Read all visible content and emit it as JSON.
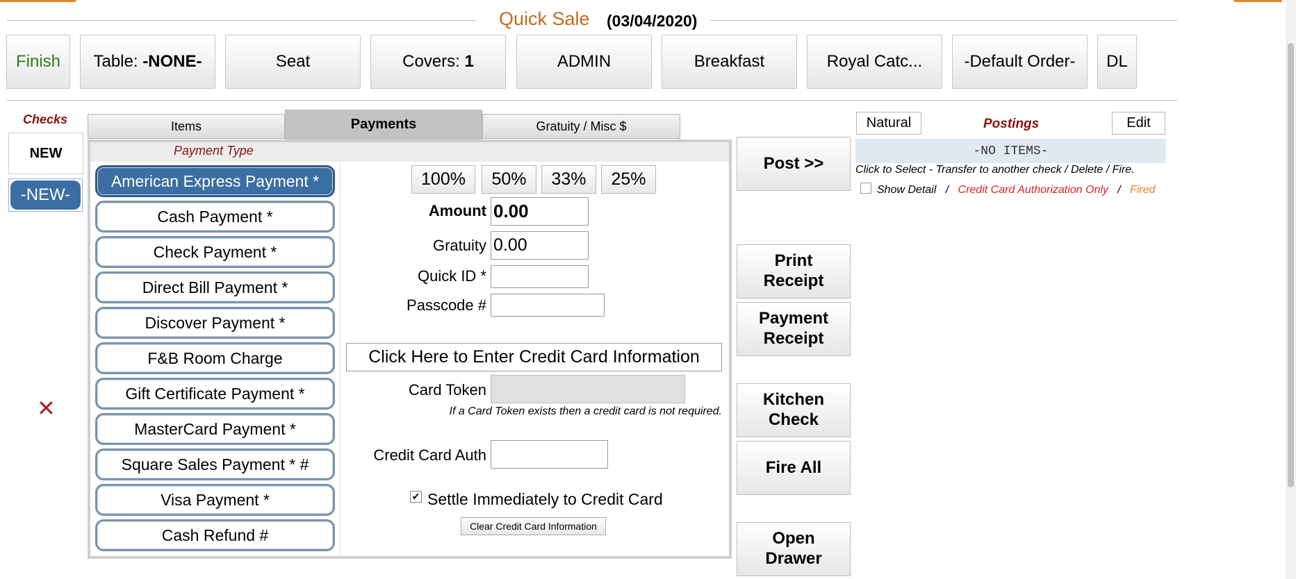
{
  "header": {
    "title": "Quick Sale",
    "date": "(03/04/2020)",
    "buttons": {
      "finish": "Finish",
      "table_label": "Table:",
      "table_value": "-NONE-",
      "seat": "Seat",
      "covers_label": "Covers:",
      "covers_value": "1",
      "admin": "ADMIN",
      "breakfast": "Breakfast",
      "royal": "Royal Catc...",
      "default_order": "-Default Order-",
      "dl": "DL"
    }
  },
  "checks": {
    "label": "Checks",
    "new_button": "NEW",
    "selected_check": "-NEW-",
    "delete_icon": "close-icon"
  },
  "tabs": {
    "items": "Items",
    "payments": "Payments",
    "gratuity": "Gratuity / Misc $"
  },
  "payments": {
    "payment_type_label": "Payment Type",
    "methods": [
      "American Express Payment *",
      "Cash Payment *",
      "Check Payment *",
      "Direct Bill Payment *",
      "Discover Payment *",
      "F&B Room Charge",
      "Gift Certificate Payment *",
      "MasterCard Payment *",
      "Square Sales Payment * #",
      "Visa Payment *",
      "Cash Refund #"
    ],
    "selected_method": "American Express Payment *",
    "percent_buttons": [
      "100%",
      "50%",
      "33%",
      "25%"
    ],
    "amount_label": "Amount",
    "amount_value": "0.00",
    "gratuity_label": "Gratuity",
    "gratuity_value": "0.00",
    "quick_id_label": "Quick ID *",
    "quick_id_value": "",
    "passcode_label": "Passcode #",
    "passcode_value": "",
    "cc_button": "Click Here to Enter Credit Card Information",
    "card_token_label": "Card Token",
    "card_token_value": "",
    "token_note": "If a Card Token exists then a credit card is not required.",
    "cc_auth_label": "Credit Card Auth",
    "cc_auth_value": "",
    "settle_label": "Settle Immediately to Credit Card",
    "settle_checked": true,
    "clear_button": "Clear Credit Card Information"
  },
  "actions": {
    "post": "Post >>",
    "print_receipt": [
      "Print",
      "Receipt"
    ],
    "payment_receipt": [
      "Payment",
      "Receipt"
    ],
    "kitchen_check": [
      "Kitchen",
      "Check"
    ],
    "fire_all": "Fire All",
    "open_drawer": [
      "Open",
      "Drawer"
    ]
  },
  "postings": {
    "natural_button": "Natural",
    "label": "Postings",
    "edit_button": "Edit",
    "no_items": "-NO ITEMS-",
    "hint": "Click to Select - Transfer to another check / Delete / Fire.",
    "show_detail": "Show Detail",
    "separator": "/",
    "cc_auth_only": "Credit Card Authorization Only",
    "fired": "Fired",
    "colors": {
      "red": "#e02020",
      "orange": "#f07a20",
      "dark_red": "#8b1111"
    }
  },
  "colors": {
    "accent_blue": "#3b6ea3",
    "title_orange": "#c26a1e",
    "finish_green": "#2e7d10"
  }
}
